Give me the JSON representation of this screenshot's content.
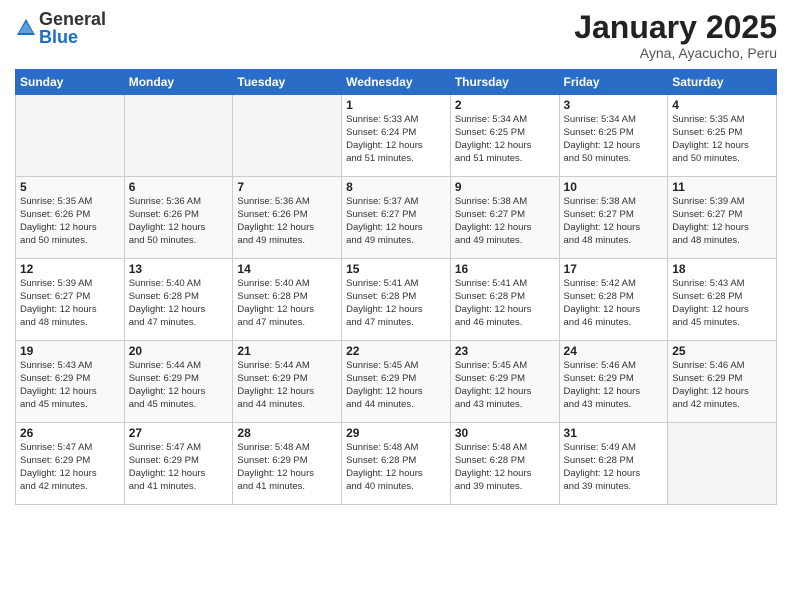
{
  "logo": {
    "general": "General",
    "blue": "Blue"
  },
  "header": {
    "month": "January 2025",
    "location": "Ayna, Ayacucho, Peru"
  },
  "weekdays": [
    "Sunday",
    "Monday",
    "Tuesday",
    "Wednesday",
    "Thursday",
    "Friday",
    "Saturday"
  ],
  "weeks": [
    [
      {
        "day": "",
        "info": ""
      },
      {
        "day": "",
        "info": ""
      },
      {
        "day": "",
        "info": ""
      },
      {
        "day": "1",
        "info": "Sunrise: 5:33 AM\nSunset: 6:24 PM\nDaylight: 12 hours\nand 51 minutes."
      },
      {
        "day": "2",
        "info": "Sunrise: 5:34 AM\nSunset: 6:25 PM\nDaylight: 12 hours\nand 51 minutes."
      },
      {
        "day": "3",
        "info": "Sunrise: 5:34 AM\nSunset: 6:25 PM\nDaylight: 12 hours\nand 50 minutes."
      },
      {
        "day": "4",
        "info": "Sunrise: 5:35 AM\nSunset: 6:25 PM\nDaylight: 12 hours\nand 50 minutes."
      }
    ],
    [
      {
        "day": "5",
        "info": "Sunrise: 5:35 AM\nSunset: 6:26 PM\nDaylight: 12 hours\nand 50 minutes."
      },
      {
        "day": "6",
        "info": "Sunrise: 5:36 AM\nSunset: 6:26 PM\nDaylight: 12 hours\nand 50 minutes."
      },
      {
        "day": "7",
        "info": "Sunrise: 5:36 AM\nSunset: 6:26 PM\nDaylight: 12 hours\nand 49 minutes."
      },
      {
        "day": "8",
        "info": "Sunrise: 5:37 AM\nSunset: 6:27 PM\nDaylight: 12 hours\nand 49 minutes."
      },
      {
        "day": "9",
        "info": "Sunrise: 5:38 AM\nSunset: 6:27 PM\nDaylight: 12 hours\nand 49 minutes."
      },
      {
        "day": "10",
        "info": "Sunrise: 5:38 AM\nSunset: 6:27 PM\nDaylight: 12 hours\nand 48 minutes."
      },
      {
        "day": "11",
        "info": "Sunrise: 5:39 AM\nSunset: 6:27 PM\nDaylight: 12 hours\nand 48 minutes."
      }
    ],
    [
      {
        "day": "12",
        "info": "Sunrise: 5:39 AM\nSunset: 6:27 PM\nDaylight: 12 hours\nand 48 minutes."
      },
      {
        "day": "13",
        "info": "Sunrise: 5:40 AM\nSunset: 6:28 PM\nDaylight: 12 hours\nand 47 minutes."
      },
      {
        "day": "14",
        "info": "Sunrise: 5:40 AM\nSunset: 6:28 PM\nDaylight: 12 hours\nand 47 minutes."
      },
      {
        "day": "15",
        "info": "Sunrise: 5:41 AM\nSunset: 6:28 PM\nDaylight: 12 hours\nand 47 minutes."
      },
      {
        "day": "16",
        "info": "Sunrise: 5:41 AM\nSunset: 6:28 PM\nDaylight: 12 hours\nand 46 minutes."
      },
      {
        "day": "17",
        "info": "Sunrise: 5:42 AM\nSunset: 6:28 PM\nDaylight: 12 hours\nand 46 minutes."
      },
      {
        "day": "18",
        "info": "Sunrise: 5:43 AM\nSunset: 6:28 PM\nDaylight: 12 hours\nand 45 minutes."
      }
    ],
    [
      {
        "day": "19",
        "info": "Sunrise: 5:43 AM\nSunset: 6:29 PM\nDaylight: 12 hours\nand 45 minutes."
      },
      {
        "day": "20",
        "info": "Sunrise: 5:44 AM\nSunset: 6:29 PM\nDaylight: 12 hours\nand 45 minutes."
      },
      {
        "day": "21",
        "info": "Sunrise: 5:44 AM\nSunset: 6:29 PM\nDaylight: 12 hours\nand 44 minutes."
      },
      {
        "day": "22",
        "info": "Sunrise: 5:45 AM\nSunset: 6:29 PM\nDaylight: 12 hours\nand 44 minutes."
      },
      {
        "day": "23",
        "info": "Sunrise: 5:45 AM\nSunset: 6:29 PM\nDaylight: 12 hours\nand 43 minutes."
      },
      {
        "day": "24",
        "info": "Sunrise: 5:46 AM\nSunset: 6:29 PM\nDaylight: 12 hours\nand 43 minutes."
      },
      {
        "day": "25",
        "info": "Sunrise: 5:46 AM\nSunset: 6:29 PM\nDaylight: 12 hours\nand 42 minutes."
      }
    ],
    [
      {
        "day": "26",
        "info": "Sunrise: 5:47 AM\nSunset: 6:29 PM\nDaylight: 12 hours\nand 42 minutes."
      },
      {
        "day": "27",
        "info": "Sunrise: 5:47 AM\nSunset: 6:29 PM\nDaylight: 12 hours\nand 41 minutes."
      },
      {
        "day": "28",
        "info": "Sunrise: 5:48 AM\nSunset: 6:29 PM\nDaylight: 12 hours\nand 41 minutes."
      },
      {
        "day": "29",
        "info": "Sunrise: 5:48 AM\nSunset: 6:28 PM\nDaylight: 12 hours\nand 40 minutes."
      },
      {
        "day": "30",
        "info": "Sunrise: 5:48 AM\nSunset: 6:28 PM\nDaylight: 12 hours\nand 39 minutes."
      },
      {
        "day": "31",
        "info": "Sunrise: 5:49 AM\nSunset: 6:28 PM\nDaylight: 12 hours\nand 39 minutes."
      },
      {
        "day": "",
        "info": ""
      }
    ]
  ]
}
